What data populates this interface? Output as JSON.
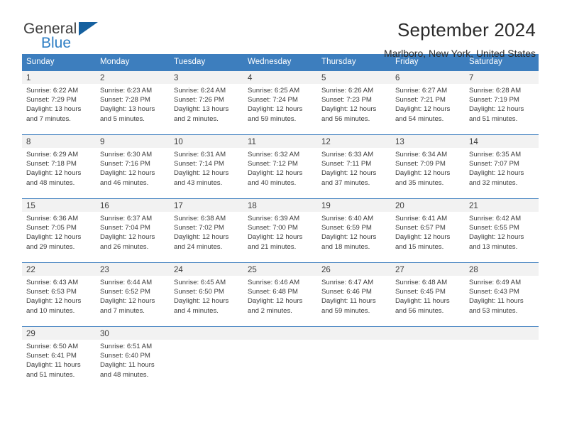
{
  "brand": {
    "name_top": "General",
    "name_bottom": "Blue",
    "accent_color": "#2e7ec4",
    "triangle_color": "#15609f"
  },
  "header": {
    "title": "September 2024",
    "location": "Marlboro, New York, United States"
  },
  "theme": {
    "header_blue": "#3d7ebe",
    "daynum_band": "#f2f2f2",
    "text": "#3c3c3c"
  },
  "calendar": {
    "weekday_headers": [
      "Sunday",
      "Monday",
      "Tuesday",
      "Wednesday",
      "Thursday",
      "Friday",
      "Saturday"
    ],
    "weeks": [
      [
        {
          "day": "1",
          "sunrise": "Sunrise: 6:22 AM",
          "sunset": "Sunset: 7:29 PM",
          "daylight_line1": "Daylight: 13 hours",
          "daylight_line2": "and 7 minutes."
        },
        {
          "day": "2",
          "sunrise": "Sunrise: 6:23 AM",
          "sunset": "Sunset: 7:28 PM",
          "daylight_line1": "Daylight: 13 hours",
          "daylight_line2": "and 5 minutes."
        },
        {
          "day": "3",
          "sunrise": "Sunrise: 6:24 AM",
          "sunset": "Sunset: 7:26 PM",
          "daylight_line1": "Daylight: 13 hours",
          "daylight_line2": "and 2 minutes."
        },
        {
          "day": "4",
          "sunrise": "Sunrise: 6:25 AM",
          "sunset": "Sunset: 7:24 PM",
          "daylight_line1": "Daylight: 12 hours",
          "daylight_line2": "and 59 minutes."
        },
        {
          "day": "5",
          "sunrise": "Sunrise: 6:26 AM",
          "sunset": "Sunset: 7:23 PM",
          "daylight_line1": "Daylight: 12 hours",
          "daylight_line2": "and 56 minutes."
        },
        {
          "day": "6",
          "sunrise": "Sunrise: 6:27 AM",
          "sunset": "Sunset: 7:21 PM",
          "daylight_line1": "Daylight: 12 hours",
          "daylight_line2": "and 54 minutes."
        },
        {
          "day": "7",
          "sunrise": "Sunrise: 6:28 AM",
          "sunset": "Sunset: 7:19 PM",
          "daylight_line1": "Daylight: 12 hours",
          "daylight_line2": "and 51 minutes."
        }
      ],
      [
        {
          "day": "8",
          "sunrise": "Sunrise: 6:29 AM",
          "sunset": "Sunset: 7:18 PM",
          "daylight_line1": "Daylight: 12 hours",
          "daylight_line2": "and 48 minutes."
        },
        {
          "day": "9",
          "sunrise": "Sunrise: 6:30 AM",
          "sunset": "Sunset: 7:16 PM",
          "daylight_line1": "Daylight: 12 hours",
          "daylight_line2": "and 46 minutes."
        },
        {
          "day": "10",
          "sunrise": "Sunrise: 6:31 AM",
          "sunset": "Sunset: 7:14 PM",
          "daylight_line1": "Daylight: 12 hours",
          "daylight_line2": "and 43 minutes."
        },
        {
          "day": "11",
          "sunrise": "Sunrise: 6:32 AM",
          "sunset": "Sunset: 7:12 PM",
          "daylight_line1": "Daylight: 12 hours",
          "daylight_line2": "and 40 minutes."
        },
        {
          "day": "12",
          "sunrise": "Sunrise: 6:33 AM",
          "sunset": "Sunset: 7:11 PM",
          "daylight_line1": "Daylight: 12 hours",
          "daylight_line2": "and 37 minutes."
        },
        {
          "day": "13",
          "sunrise": "Sunrise: 6:34 AM",
          "sunset": "Sunset: 7:09 PM",
          "daylight_line1": "Daylight: 12 hours",
          "daylight_line2": "and 35 minutes."
        },
        {
          "day": "14",
          "sunrise": "Sunrise: 6:35 AM",
          "sunset": "Sunset: 7:07 PM",
          "daylight_line1": "Daylight: 12 hours",
          "daylight_line2": "and 32 minutes."
        }
      ],
      [
        {
          "day": "15",
          "sunrise": "Sunrise: 6:36 AM",
          "sunset": "Sunset: 7:05 PM",
          "daylight_line1": "Daylight: 12 hours",
          "daylight_line2": "and 29 minutes."
        },
        {
          "day": "16",
          "sunrise": "Sunrise: 6:37 AM",
          "sunset": "Sunset: 7:04 PM",
          "daylight_line1": "Daylight: 12 hours",
          "daylight_line2": "and 26 minutes."
        },
        {
          "day": "17",
          "sunrise": "Sunrise: 6:38 AM",
          "sunset": "Sunset: 7:02 PM",
          "daylight_line1": "Daylight: 12 hours",
          "daylight_line2": "and 24 minutes."
        },
        {
          "day": "18",
          "sunrise": "Sunrise: 6:39 AM",
          "sunset": "Sunset: 7:00 PM",
          "daylight_line1": "Daylight: 12 hours",
          "daylight_line2": "and 21 minutes."
        },
        {
          "day": "19",
          "sunrise": "Sunrise: 6:40 AM",
          "sunset": "Sunset: 6:59 PM",
          "daylight_line1": "Daylight: 12 hours",
          "daylight_line2": "and 18 minutes."
        },
        {
          "day": "20",
          "sunrise": "Sunrise: 6:41 AM",
          "sunset": "Sunset: 6:57 PM",
          "daylight_line1": "Daylight: 12 hours",
          "daylight_line2": "and 15 minutes."
        },
        {
          "day": "21",
          "sunrise": "Sunrise: 6:42 AM",
          "sunset": "Sunset: 6:55 PM",
          "daylight_line1": "Daylight: 12 hours",
          "daylight_line2": "and 13 minutes."
        }
      ],
      [
        {
          "day": "22",
          "sunrise": "Sunrise: 6:43 AM",
          "sunset": "Sunset: 6:53 PM",
          "daylight_line1": "Daylight: 12 hours",
          "daylight_line2": "and 10 minutes."
        },
        {
          "day": "23",
          "sunrise": "Sunrise: 6:44 AM",
          "sunset": "Sunset: 6:52 PM",
          "daylight_line1": "Daylight: 12 hours",
          "daylight_line2": "and 7 minutes."
        },
        {
          "day": "24",
          "sunrise": "Sunrise: 6:45 AM",
          "sunset": "Sunset: 6:50 PM",
          "daylight_line1": "Daylight: 12 hours",
          "daylight_line2": "and 4 minutes."
        },
        {
          "day": "25",
          "sunrise": "Sunrise: 6:46 AM",
          "sunset": "Sunset: 6:48 PM",
          "daylight_line1": "Daylight: 12 hours",
          "daylight_line2": "and 2 minutes."
        },
        {
          "day": "26",
          "sunrise": "Sunrise: 6:47 AM",
          "sunset": "Sunset: 6:46 PM",
          "daylight_line1": "Daylight: 11 hours",
          "daylight_line2": "and 59 minutes."
        },
        {
          "day": "27",
          "sunrise": "Sunrise: 6:48 AM",
          "sunset": "Sunset: 6:45 PM",
          "daylight_line1": "Daylight: 11 hours",
          "daylight_line2": "and 56 minutes."
        },
        {
          "day": "28",
          "sunrise": "Sunrise: 6:49 AM",
          "sunset": "Sunset: 6:43 PM",
          "daylight_line1": "Daylight: 11 hours",
          "daylight_line2": "and 53 minutes."
        }
      ],
      [
        {
          "day": "29",
          "sunrise": "Sunrise: 6:50 AM",
          "sunset": "Sunset: 6:41 PM",
          "daylight_line1": "Daylight: 11 hours",
          "daylight_line2": "and 51 minutes."
        },
        {
          "day": "30",
          "sunrise": "Sunrise: 6:51 AM",
          "sunset": "Sunset: 6:40 PM",
          "daylight_line1": "Daylight: 11 hours",
          "daylight_line2": "and 48 minutes."
        },
        {
          "day": "",
          "sunrise": "",
          "sunset": "",
          "daylight_line1": "",
          "daylight_line2": ""
        },
        {
          "day": "",
          "sunrise": "",
          "sunset": "",
          "daylight_line1": "",
          "daylight_line2": ""
        },
        {
          "day": "",
          "sunrise": "",
          "sunset": "",
          "daylight_line1": "",
          "daylight_line2": ""
        },
        {
          "day": "",
          "sunrise": "",
          "sunset": "",
          "daylight_line1": "",
          "daylight_line2": ""
        },
        {
          "day": "",
          "sunrise": "",
          "sunset": "",
          "daylight_line1": "",
          "daylight_line2": ""
        }
      ]
    ]
  }
}
